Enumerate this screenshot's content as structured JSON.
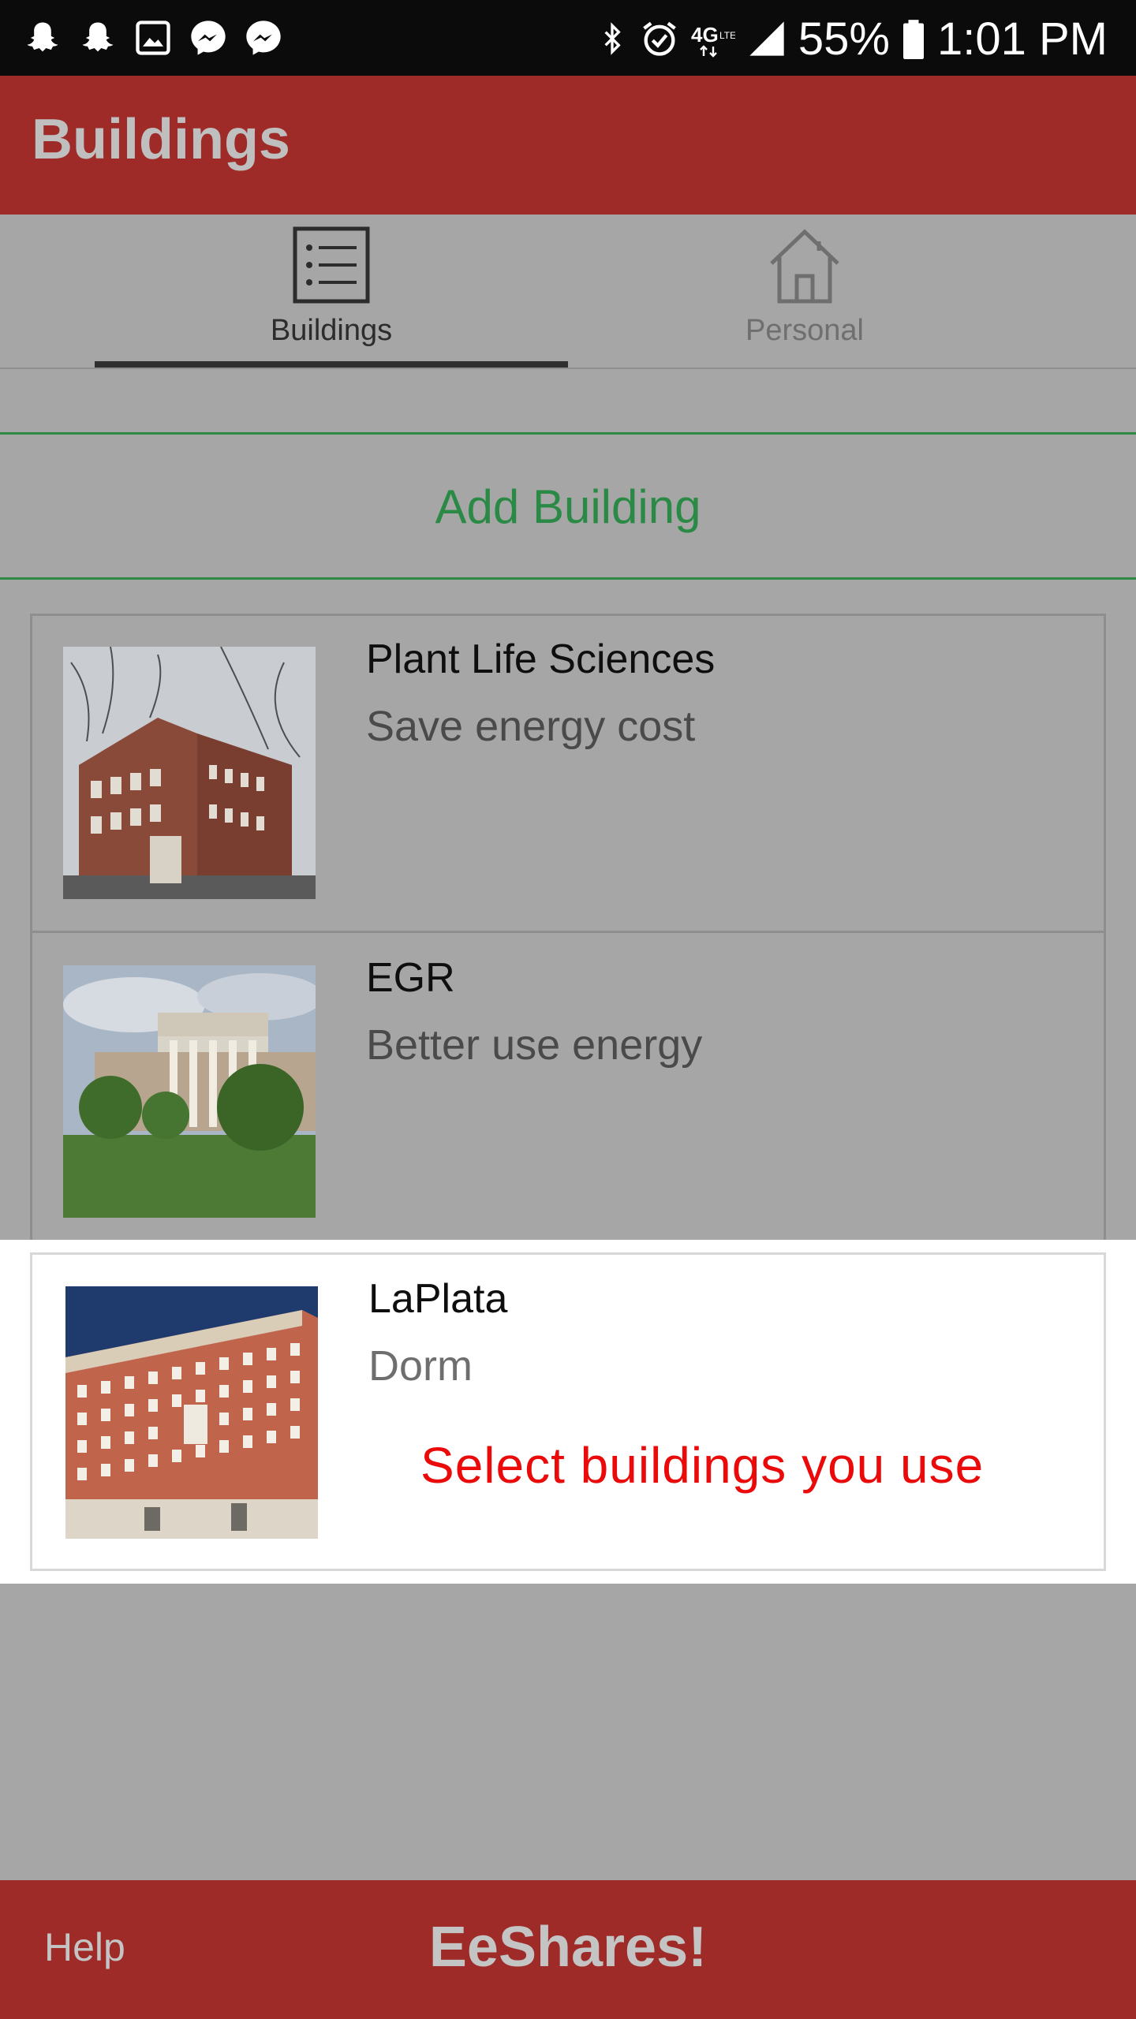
{
  "status_bar": {
    "left_icons": [
      "snapchat-icon",
      "snapchat-icon",
      "gallery-icon",
      "messenger-icon",
      "messenger-icon"
    ],
    "right_icons": [
      "bluetooth-icon",
      "alarm-icon",
      "4g-lte-icon",
      "signal-icon",
      "battery-icon"
    ],
    "battery": "55%",
    "time": "1:01 PM"
  },
  "appbar": {
    "title": "Buildings"
  },
  "tabs": [
    {
      "label": "Buildings",
      "icon": "list-icon",
      "selected": true
    },
    {
      "label": "Personal",
      "icon": "house-icon",
      "selected": false
    }
  ],
  "add_building": {
    "label": "Add Building",
    "color": "#2a8a45"
  },
  "buildings": [
    {
      "name": "Plant Life Sciences",
      "subtitle": "Save energy cost",
      "image": "brick-building-photo"
    },
    {
      "name": "EGR",
      "subtitle": "Better use energy",
      "image": "columned-hall-photo"
    },
    {
      "name": "LaPlata",
      "subtitle": "Dorm",
      "image": "brick-dorm-photo"
    }
  ],
  "hint": {
    "text": "Select buildings you use",
    "color": "#ea0a0a"
  },
  "footer": {
    "help": "Help",
    "brand": "EeShares!"
  },
  "colors": {
    "accent": "#9e2b28",
    "green": "#2a8a45"
  }
}
